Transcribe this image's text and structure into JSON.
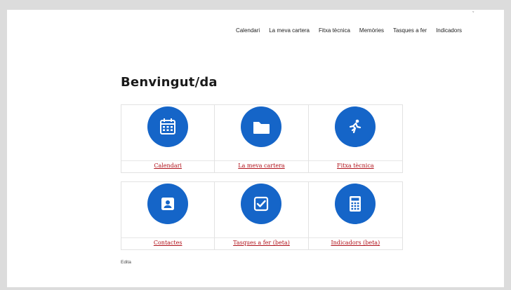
{
  "nav": [
    "Calendari",
    "La meva cartera",
    "Fitxa tècnica",
    "Memòries",
    "Tasques a fer",
    "Indicadors"
  ],
  "page": {
    "title": "Benvingut/da",
    "edit_link": "Edita"
  },
  "tiles": [
    {
      "label": "Calendari",
      "icon": "calendar-icon"
    },
    {
      "label": "La meva cartera",
      "icon": "folder-icon"
    },
    {
      "label": "Fitxa tècnica",
      "icon": "runner-icon"
    },
    {
      "label": "Contactes",
      "icon": "contact-card-icon"
    },
    {
      "label": "Tasques a fer (beta)",
      "icon": "checkbox-icon"
    },
    {
      "label": "Indicadors (beta)",
      "icon": "calculator-icon"
    }
  ],
  "colors": {
    "icon_bg": "#1565c8",
    "link": "#b0111a"
  }
}
